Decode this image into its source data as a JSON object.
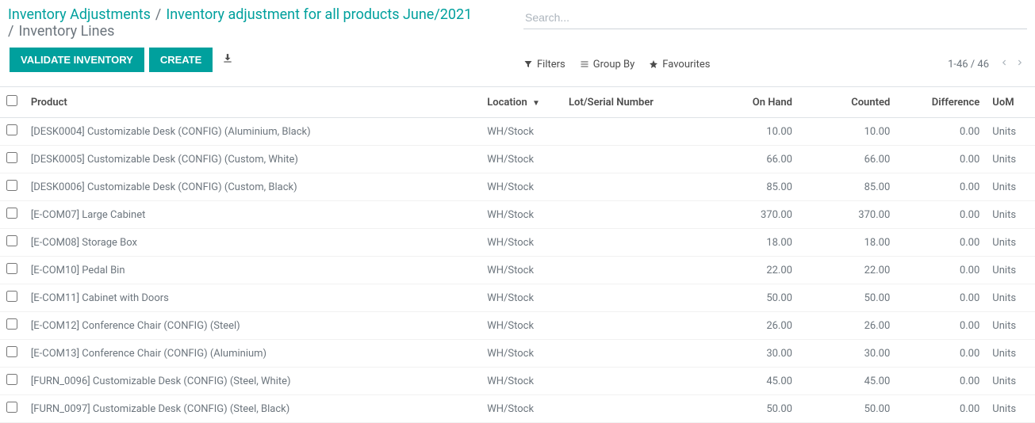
{
  "breadcrumb": {
    "root": "Inventory Adjustments",
    "parent": "Inventory adjustment for all products June/2021",
    "current": "Inventory Lines"
  },
  "toolbar": {
    "validate_label": "VALIDATE INVENTORY",
    "create_label": "CREATE"
  },
  "search": {
    "placeholder": "Search..."
  },
  "filters": {
    "filters_label": "Filters",
    "groupby_label": "Group By",
    "favourites_label": "Favourites"
  },
  "pager": {
    "range": "1-46 / 46"
  },
  "table": {
    "headers": {
      "product": "Product",
      "location": "Location",
      "lot": "Lot/Serial Number",
      "onhand": "On Hand",
      "counted": "Counted",
      "difference": "Difference",
      "uom": "UoM"
    },
    "rows": [
      {
        "product": "[DESK0004] Customizable Desk (CONFIG) (Aluminium, Black)",
        "location": "WH/Stock",
        "lot": "",
        "onhand": "10.00",
        "counted": "10.00",
        "difference": "0.00",
        "uom": "Units"
      },
      {
        "product": "[DESK0005] Customizable Desk (CONFIG) (Custom, White)",
        "location": "WH/Stock",
        "lot": "",
        "onhand": "66.00",
        "counted": "66.00",
        "difference": "0.00",
        "uom": "Units"
      },
      {
        "product": "[DESK0006] Customizable Desk (CONFIG) (Custom, Black)",
        "location": "WH/Stock",
        "lot": "",
        "onhand": "85.00",
        "counted": "85.00",
        "difference": "0.00",
        "uom": "Units"
      },
      {
        "product": "[E-COM07] Large Cabinet",
        "location": "WH/Stock",
        "lot": "",
        "onhand": "370.00",
        "counted": "370.00",
        "difference": "0.00",
        "uom": "Units"
      },
      {
        "product": "[E-COM08] Storage Box",
        "location": "WH/Stock",
        "lot": "",
        "onhand": "18.00",
        "counted": "18.00",
        "difference": "0.00",
        "uom": "Units"
      },
      {
        "product": "[E-COM10] Pedal Bin",
        "location": "WH/Stock",
        "lot": "",
        "onhand": "22.00",
        "counted": "22.00",
        "difference": "0.00",
        "uom": "Units"
      },
      {
        "product": "[E-COM11] Cabinet with Doors",
        "location": "WH/Stock",
        "lot": "",
        "onhand": "50.00",
        "counted": "50.00",
        "difference": "0.00",
        "uom": "Units"
      },
      {
        "product": "[E-COM12] Conference Chair (CONFIG) (Steel)",
        "location": "WH/Stock",
        "lot": "",
        "onhand": "26.00",
        "counted": "26.00",
        "difference": "0.00",
        "uom": "Units"
      },
      {
        "product": "[E-COM13] Conference Chair (CONFIG) (Aluminium)",
        "location": "WH/Stock",
        "lot": "",
        "onhand": "30.00",
        "counted": "30.00",
        "difference": "0.00",
        "uom": "Units"
      },
      {
        "product": "[FURN_0096] Customizable Desk (CONFIG) (Steel, White)",
        "location": "WH/Stock",
        "lot": "",
        "onhand": "45.00",
        "counted": "45.00",
        "difference": "0.00",
        "uom": "Units"
      },
      {
        "product": "[FURN_0097] Customizable Desk (CONFIG) (Steel, Black)",
        "location": "WH/Stock",
        "lot": "",
        "onhand": "50.00",
        "counted": "50.00",
        "difference": "0.00",
        "uom": "Units"
      }
    ]
  }
}
